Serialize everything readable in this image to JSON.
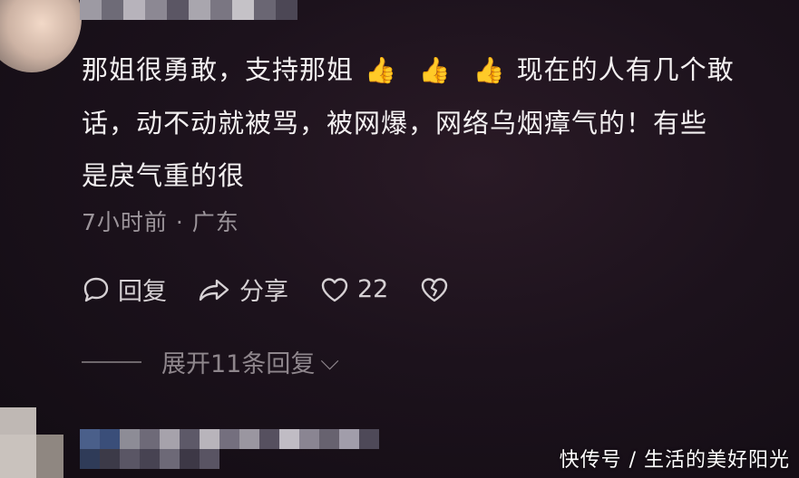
{
  "comment": {
    "line1_a": "那姐很勇敢，支持那姐",
    "line1_b": "现在的人有几个敢",
    "line2": "话，动不动就被骂，被网爆，网络乌烟瘴气的！有些",
    "line3": "是戾气重的很",
    "thumb_emoji": "👍"
  },
  "meta": {
    "time": "7小时前",
    "separator": "·",
    "location": "广东"
  },
  "actions": {
    "reply_label": "回复",
    "share_label": "分享",
    "like_count": "22"
  },
  "expand": {
    "label": "展开11条回复",
    "chevron": "⌵"
  },
  "watermark": "快传号 / 生活的美好阳光"
}
